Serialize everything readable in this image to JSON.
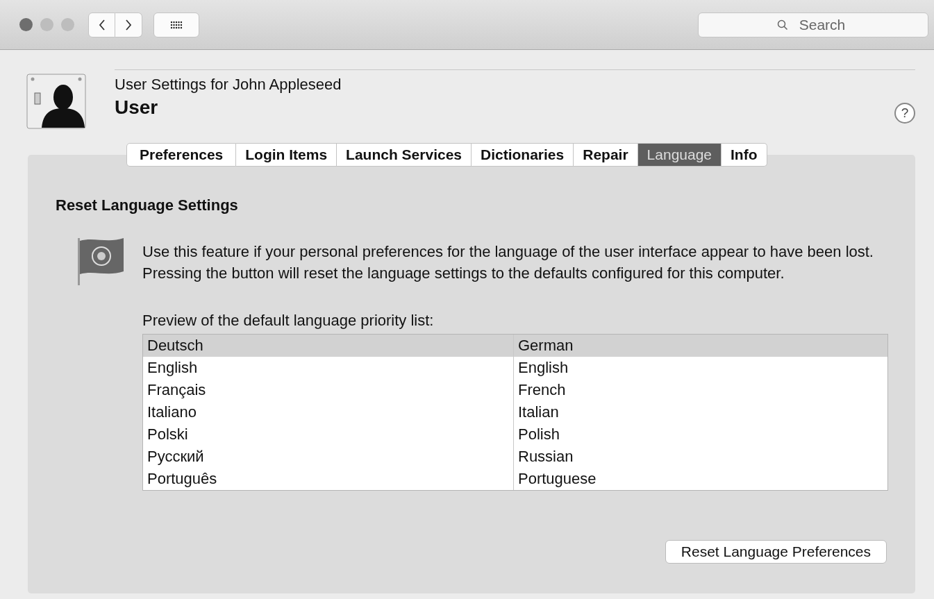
{
  "toolbar": {
    "search": {
      "placeholder": "Search"
    }
  },
  "header": {
    "subtitle": "User Settings for John Appleseed",
    "title": "User",
    "help": "?"
  },
  "tabs": [
    {
      "label": "Preferences",
      "selected": false
    },
    {
      "label": "Login Items",
      "selected": false
    },
    {
      "label": "Launch Services",
      "selected": false
    },
    {
      "label": "Dictionaries",
      "selected": false
    },
    {
      "label": "Repair",
      "selected": false
    },
    {
      "label": "Language",
      "selected": true
    },
    {
      "label": "Info",
      "selected": false
    }
  ],
  "section": {
    "title": "Reset Language Settings",
    "description": "Use this feature if your personal preferences for the language of the user interface appear to have been lost. Pressing the button will reset the language settings to the defaults configured for this computer.",
    "preview_label": "Preview of the default language priority list:"
  },
  "table": {
    "rows": [
      {
        "native": "Deutsch",
        "english": "German",
        "selected": true
      },
      {
        "native": "English",
        "english": "English",
        "selected": false
      },
      {
        "native": "Français",
        "english": "French",
        "selected": false
      },
      {
        "native": "Italiano",
        "english": "Italian",
        "selected": false
      },
      {
        "native": "Polski",
        "english": "Polish",
        "selected": false
      },
      {
        "native": "Русский",
        "english": "Russian",
        "selected": false
      },
      {
        "native": "Português",
        "english": "Portuguese",
        "selected": false
      }
    ]
  },
  "buttons": [
    {
      "label": "Reset Language Preferences"
    }
  ]
}
